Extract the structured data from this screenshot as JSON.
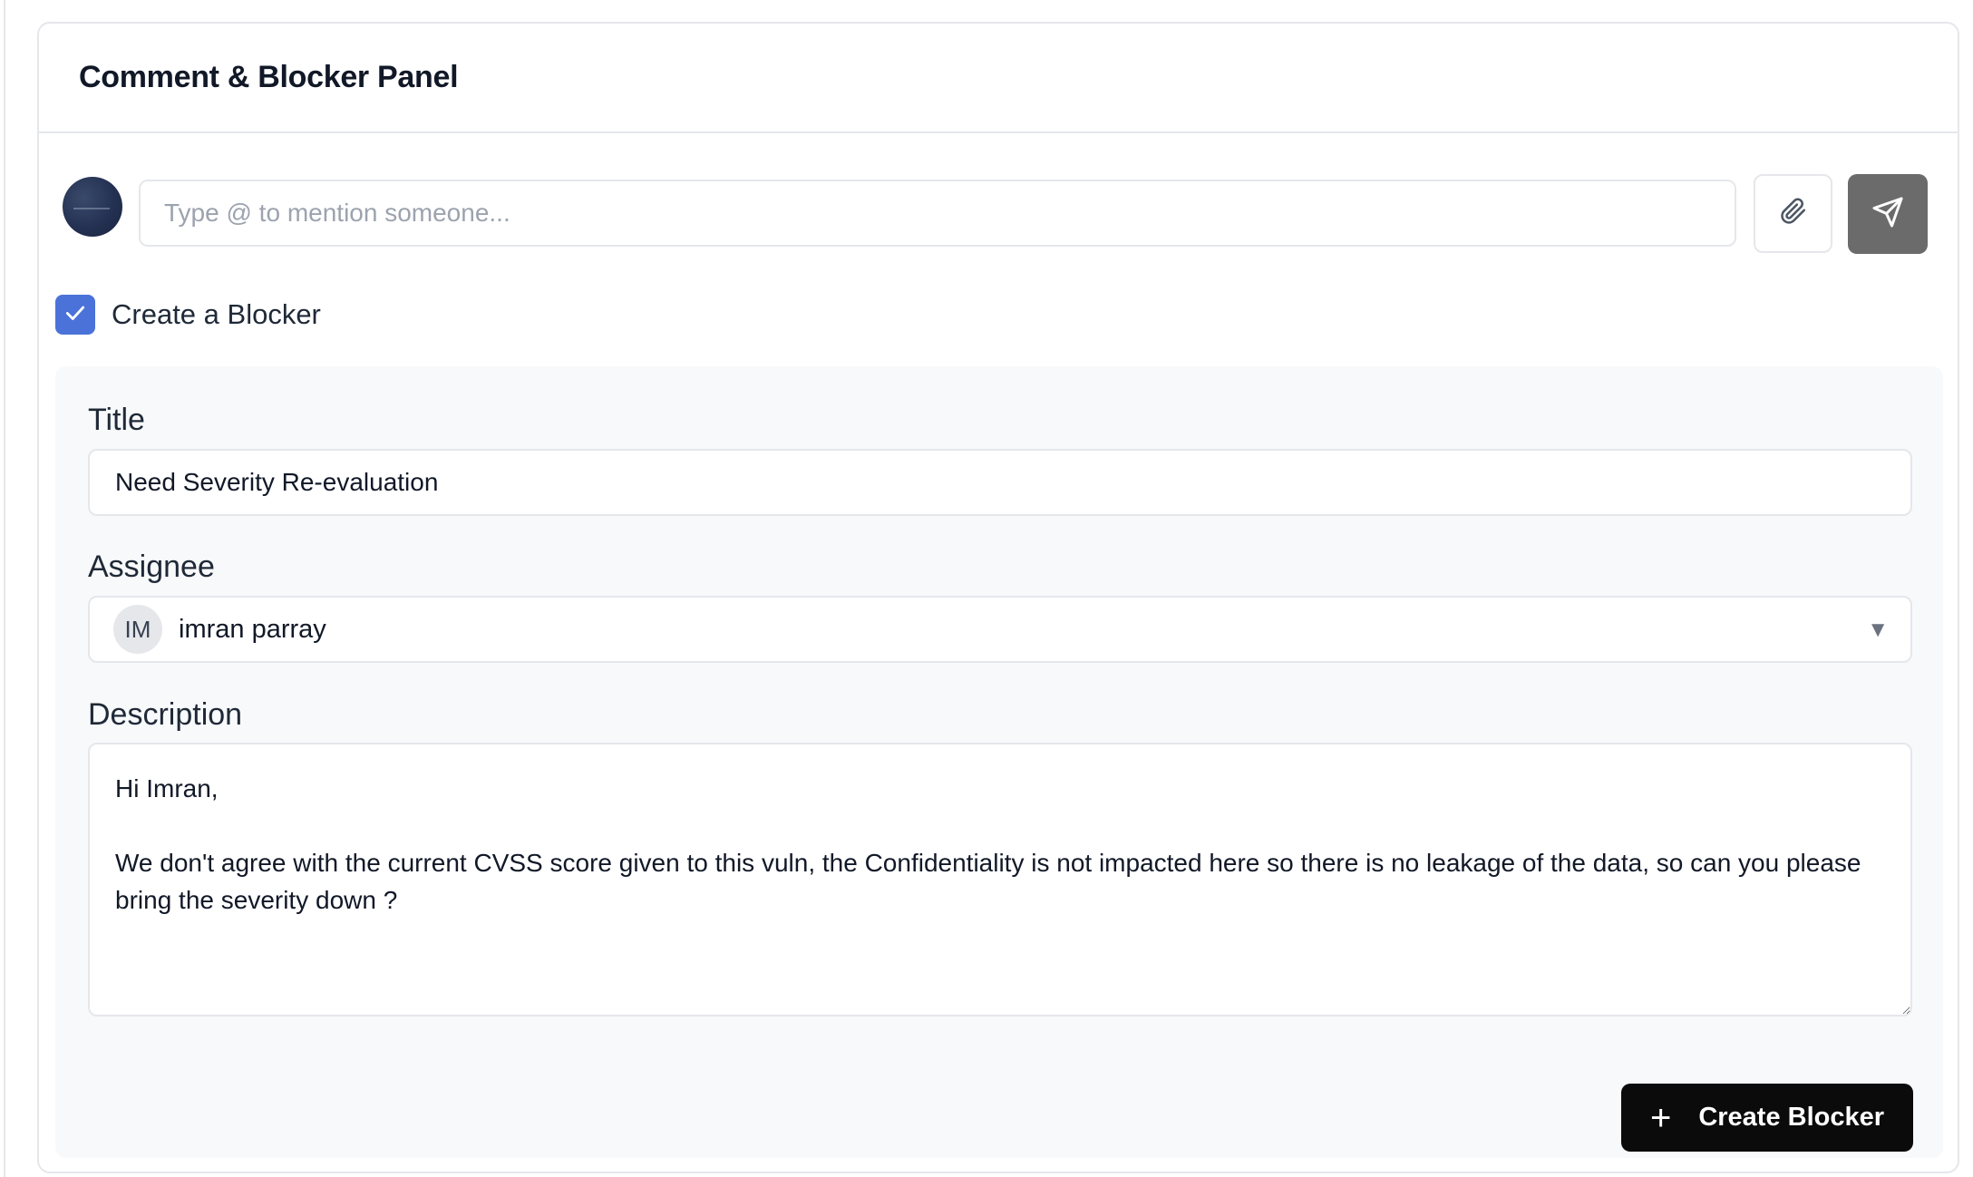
{
  "panel": {
    "title": "Comment & Blocker Panel"
  },
  "comment": {
    "placeholder": "Type @ to mention someone...",
    "avatar_icon": "user-avatar-icon",
    "attach_icon": "paperclip-icon",
    "send_icon": "send-icon"
  },
  "blocker_toggle": {
    "label": "Create a Blocker",
    "checked": true
  },
  "form": {
    "title_label": "Title",
    "title_value": "Need Severity Re-evaluation",
    "assignee_label": "Assignee",
    "assignee_initials": "IM",
    "assignee_name": "imran parray",
    "description_label": "Description",
    "description_value": "Hi Imran,\n\nWe don't agree with the current CVSS score given to this vuln, the Confidentiality is not impacted here so there is no leakage of the data, so can you please bring the severity down ?",
    "submit_label": "Create Blocker"
  },
  "colors": {
    "accent": "#4a72d9",
    "send_button": "#6b6b6b",
    "primary_button": "#0b0b0b",
    "form_background": "#f8f9fb"
  }
}
